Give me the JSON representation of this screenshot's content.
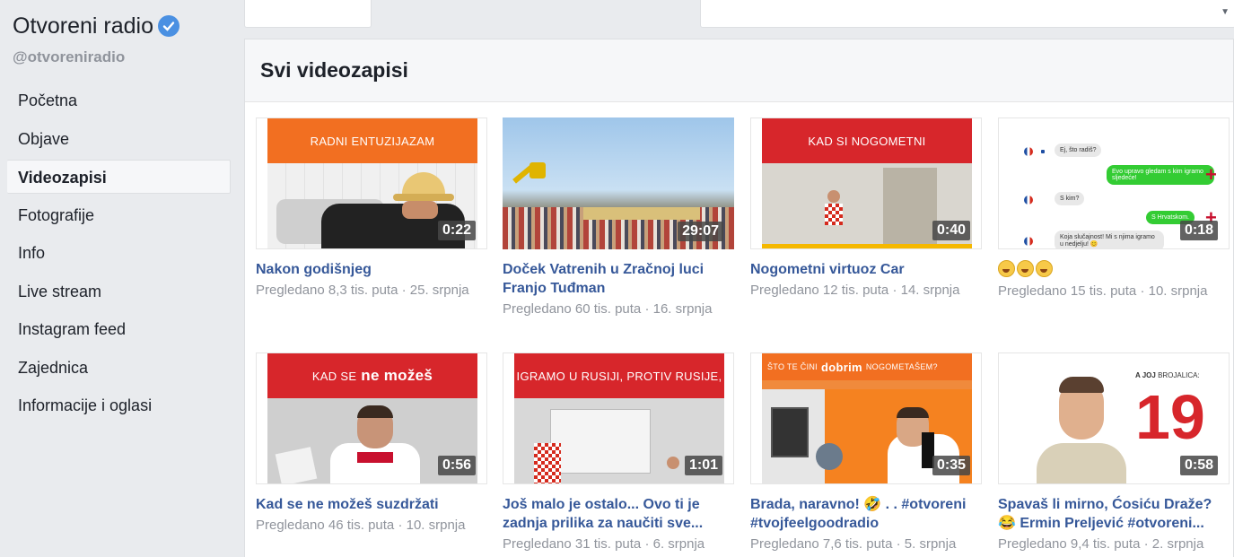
{
  "sidebar": {
    "page_name": "Otvoreni radio",
    "handle": "@otvoreniradio",
    "nav": [
      {
        "label": "Početna",
        "active": false
      },
      {
        "label": "Objave",
        "active": false
      },
      {
        "label": "Videozapisi",
        "active": true
      },
      {
        "label": "Fotografije",
        "active": false
      },
      {
        "label": "Info",
        "active": false
      },
      {
        "label": "Live stream",
        "active": false
      },
      {
        "label": "Instagram feed",
        "active": false
      },
      {
        "label": "Zajednica",
        "active": false
      },
      {
        "label": "Informacije i oglasi",
        "active": false
      }
    ]
  },
  "main": {
    "section_title": "Svi videozapisi",
    "videos": [
      {
        "title": "Nakon godišnjeg",
        "meta": "Pregledano 8,3 tis. puta · 25. srpnja",
        "duration": "0:22",
        "banner": "RADNI ENTUZIJAZAM"
      },
      {
        "title": "Doček Vatrenih u Zračnoj luci Franjo Tuđman",
        "meta": "Pregledano 60 tis. puta · 16. srpnja",
        "duration": "29:07"
      },
      {
        "title": "Nogometni virtuoz Car",
        "meta": "Pregledano 12 tis. puta · 14. srpnja",
        "duration": "0:40",
        "banner": "KAD SI NOGOMETNI"
      },
      {
        "title": "",
        "meta": "Pregledano 15 tis. puta · 10. srpnja",
        "duration": "0:18",
        "chat": [
          "Ej, što radiš?",
          "Evo upravo gledam s kim igramo sljedeće!",
          "S kim?",
          "S Hrvatskom.",
          "Koja slučajnost! Mi s njima igramo u nedjelju! 😊"
        ]
      },
      {
        "title": "Kad se ne možeš suzdržati",
        "meta": "Pregledano 46 tis. puta · 10. srpnja",
        "duration": "0:56",
        "banner": "KAD SE",
        "banner_bold": "ne možeš"
      },
      {
        "title": "Još malo je ostalo... Ovo ti je zadnja prilika za naučiti sve...",
        "meta": "Pregledano 31 tis. puta · 6. srpnja",
        "duration": "1:01",
        "banner": "IGRAMO U RUSIJI, PROTIV RUSIJE,"
      },
      {
        "title": "Brada, naravno! 🤣 . . #otvoreni #tvojfeelgoodradio",
        "meta": "Pregledano 7,6 tis. puta · 5. srpnja",
        "duration": "0:35",
        "banner": "ŠTO TE ČINI",
        "banner_bold": "dobrim",
        "banner_tail": "NOGOMETAŠEM?"
      },
      {
        "title": "Spavaš li mirno, Ćosiću Draže? 😂 Ermin Preljević #otvoreni...",
        "meta": "Pregledano 9,4 tis. puta · 2. srpnja",
        "duration": "0:58",
        "banner": "A JOJ",
        "banner_tail": "BROJALICA:",
        "big_number": "19"
      }
    ]
  },
  "colors": {
    "accent_blue": "#365899",
    "orange_banner": "#f26f21",
    "red_banner": "#d7262b",
    "verified": "#4a90e2"
  }
}
